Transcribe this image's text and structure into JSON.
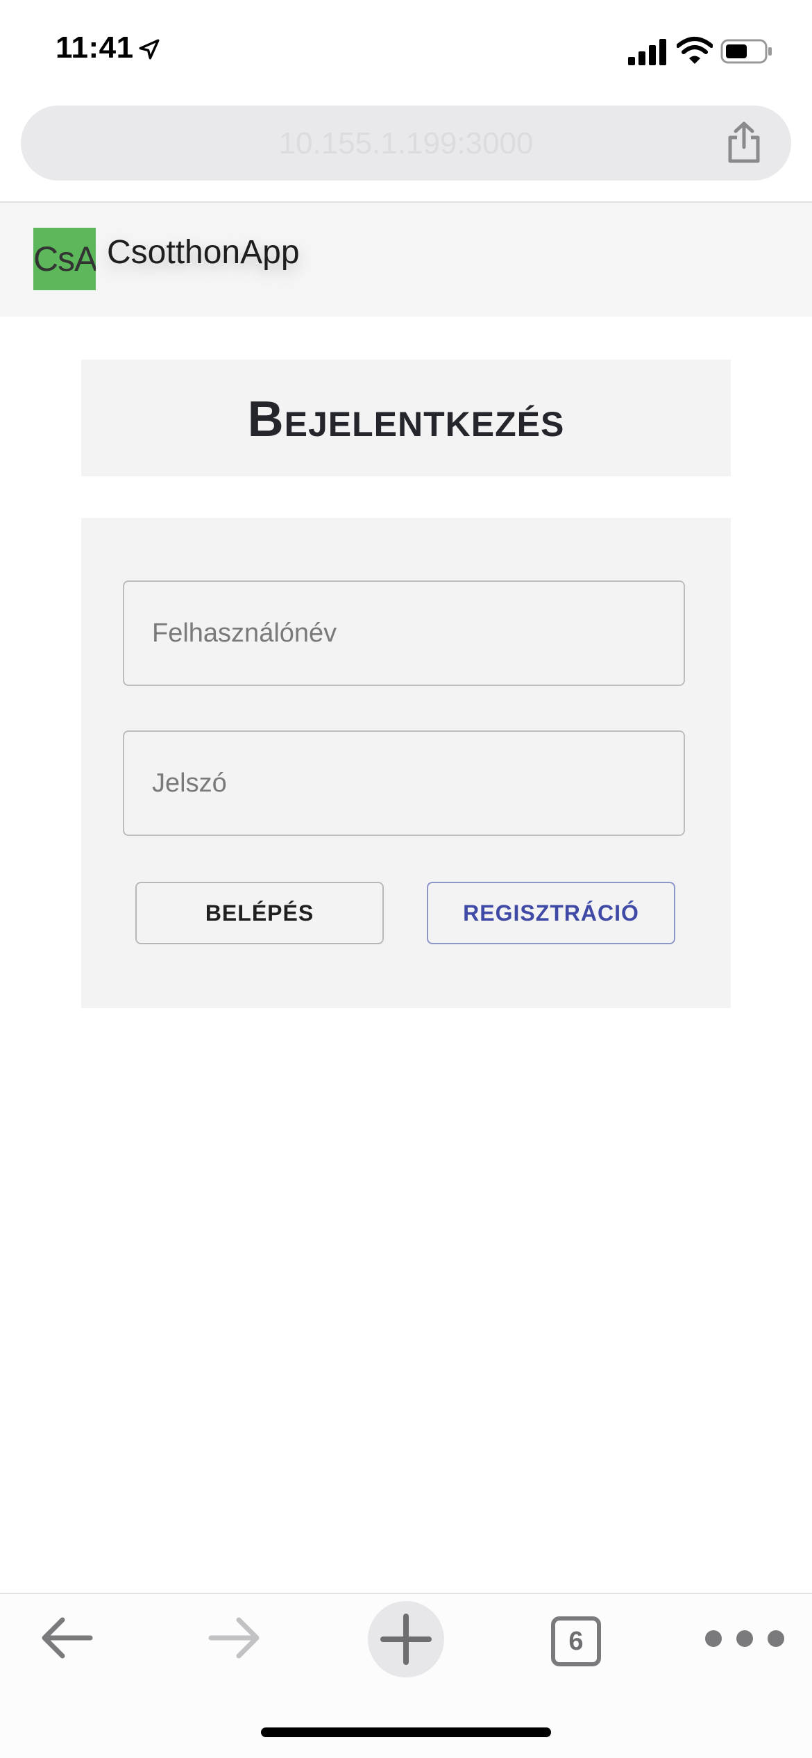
{
  "status_bar": {
    "time": "11:41",
    "icons": [
      "location-arrow-icon",
      "cellular-signal-icon",
      "wifi-icon",
      "battery-icon"
    ]
  },
  "browser": {
    "url": "10.155.1.199:3000",
    "share_icon": "share-icon"
  },
  "app": {
    "logo_text": "CsA",
    "logo_color": "#5db85b",
    "name": "CsotthonApp"
  },
  "page": {
    "title": "Bejelentkezés"
  },
  "form": {
    "username_placeholder": "Felhasználónév",
    "password_placeholder": "Jelszó",
    "login_label": "BELÉPÉS",
    "register_label": "REGISZTRÁCIÓ",
    "register_color": "#3f4aa6"
  },
  "toolbar": {
    "tab_count": "6",
    "icons": [
      "back-arrow-icon",
      "forward-arrow-icon",
      "new-tab-plus-icon",
      "tabs-icon",
      "more-icon"
    ]
  }
}
